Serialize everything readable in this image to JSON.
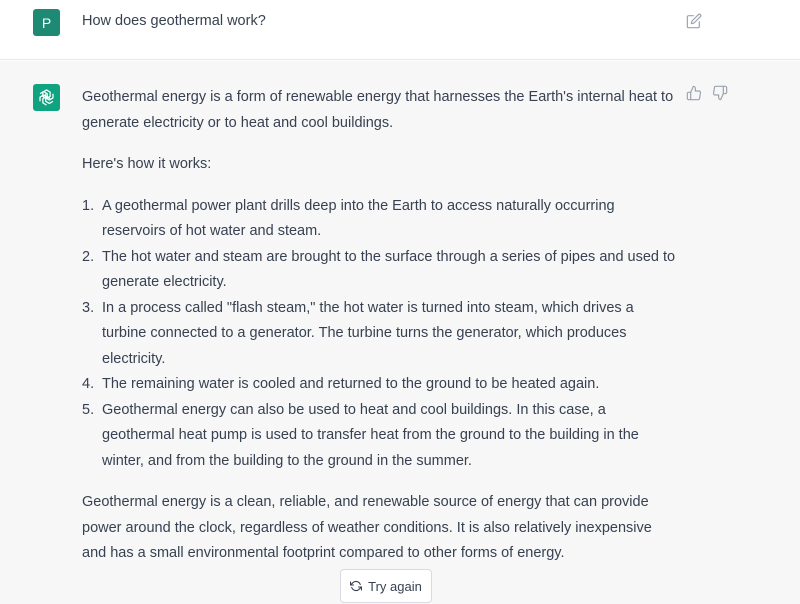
{
  "user": {
    "avatar_letter": "P",
    "message": "How does geothermal work?"
  },
  "assistant": {
    "intro": "Geothermal energy is a form of renewable energy that harnesses the Earth's internal heat to generate electricity or to heat and cool buildings.",
    "lead": "Here's how it works:",
    "steps": [
      "A geothermal power plant drills deep into the Earth to access naturally occurring reservoirs of hot water and steam.",
      "The hot water and steam are brought to the surface through a series of pipes and used to generate electricity.",
      "In a process called \"flash steam,\" the hot water is turned into steam, which drives a turbine connected to a generator. The turbine turns the generator, which produces electricity.",
      "The remaining water is cooled and returned to the ground to be heated again.",
      "Geothermal energy can also be used to heat and cool buildings. In this case, a geothermal heat pump is used to transfer heat from the ground to the building in the winter, and from the building to the ground in the summer."
    ],
    "step_numbers": [
      "1.",
      "2.",
      "3.",
      "4.",
      "5."
    ],
    "conclusion": "Geothermal energy is a clean, reliable, and renewable source of energy that can provide power around the clock, regardless of weather conditions. It is also relatively inexpensive and has a small environmental footprint compared to other forms of energy."
  },
  "actions": {
    "try_again_label": "Try again"
  },
  "icons": {
    "edit": "edit-icon",
    "thumbs_up": "thumbs-up-icon",
    "thumbs_down": "thumbs-down-icon",
    "openai_logo": "openai-logo-icon",
    "refresh": "refresh-icon"
  },
  "colors": {
    "user_avatar": "#1e8a73",
    "bot_avatar": "#10a37f",
    "assistant_bg": "#f7f7f8",
    "text": "#374151"
  }
}
